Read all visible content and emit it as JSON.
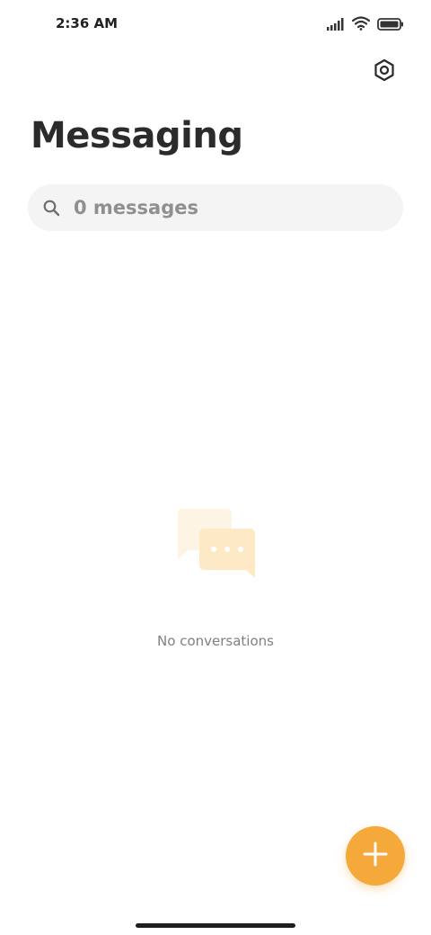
{
  "status_bar": {
    "time": "2:36 AM",
    "icons": [
      "signal-icon",
      "wifi-icon",
      "battery-icon"
    ]
  },
  "header": {
    "settings_icon": "gear-icon",
    "title": "Messaging"
  },
  "search": {
    "icon": "search-icon",
    "placeholder": "0 messages"
  },
  "empty_state": {
    "illustration": "chat-bubbles-icon",
    "text": "No conversations"
  },
  "fab": {
    "icon": "plus-icon",
    "color": "#f5a93a"
  },
  "colors": {
    "accent": "#f5a93a",
    "illustration_light": "#fdf4e3",
    "illustration_mid": "#fde9c5"
  }
}
